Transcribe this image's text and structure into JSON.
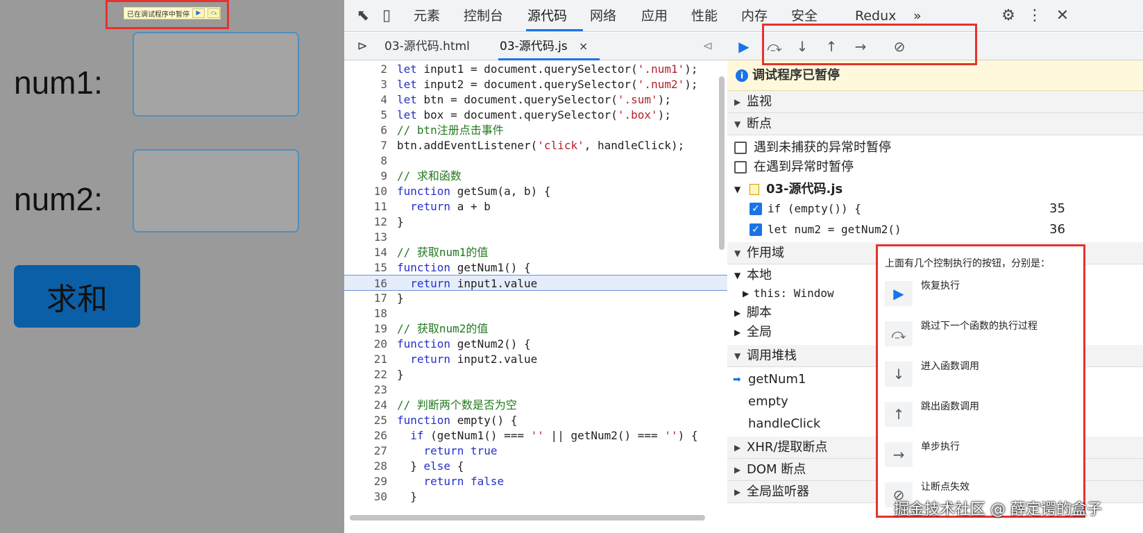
{
  "page": {
    "paused_banner": "已在调试程序中暂停",
    "num1_label": "num1:",
    "num2_label": "num2:",
    "sum_button": "求和"
  },
  "devtools": {
    "tabs": [
      "元素",
      "控制台",
      "源代码",
      "网络",
      "应用",
      "性能",
      "内存",
      "安全",
      "Redux"
    ],
    "more_tabs": "»",
    "file_tabs": [
      "03-源代码.html",
      "03-源代码.js"
    ],
    "file_tab_close": "×"
  },
  "code": {
    "lines": [
      {
        "n": "2",
        "t": "let input1 = document.querySelector('.num1');"
      },
      {
        "n": "3",
        "t": "let input2 = document.querySelector('.num2');"
      },
      {
        "n": "4",
        "t": "let btn = document.querySelector('.sum');"
      },
      {
        "n": "5",
        "t": "let box = document.querySelector('.box');"
      },
      {
        "n": "6",
        "t": "// btn注册点击事件"
      },
      {
        "n": "7",
        "t": "btn.addEventListener('click', handleClick);"
      },
      {
        "n": "8",
        "t": ""
      },
      {
        "n": "9",
        "t": "// 求和函数"
      },
      {
        "n": "10",
        "t": "function getSum(a, b) {"
      },
      {
        "n": "11",
        "t": "  return a + b"
      },
      {
        "n": "12",
        "t": "}"
      },
      {
        "n": "13",
        "t": ""
      },
      {
        "n": "14",
        "t": "// 获取num1的值"
      },
      {
        "n": "15",
        "t": "function getNum1() {"
      },
      {
        "n": "16",
        "t": "  return input1.value"
      },
      {
        "n": "17",
        "t": "}"
      },
      {
        "n": "18",
        "t": ""
      },
      {
        "n": "19",
        "t": "// 获取num2的值"
      },
      {
        "n": "20",
        "t": "function getNum2() {"
      },
      {
        "n": "21",
        "t": "  return input2.value"
      },
      {
        "n": "22",
        "t": "}"
      },
      {
        "n": "23",
        "t": ""
      },
      {
        "n": "24",
        "t": "// 判断两个数是否为空"
      },
      {
        "n": "25",
        "t": "function empty() {"
      },
      {
        "n": "26",
        "t": "  if (getNum1() === '' || getNum2() === '') {"
      },
      {
        "n": "27",
        "t": "    return true"
      },
      {
        "n": "28",
        "t": "  } else {"
      },
      {
        "n": "29",
        "t": "    return false"
      },
      {
        "n": "30",
        "t": "  }"
      }
    ],
    "current_line": "16"
  },
  "debugger": {
    "paused_text": "调试程序已暂停",
    "watch": "监视",
    "breakpoints": "断点",
    "pause_uncaught": "遇到未捕获的异常时暂停",
    "pause_caught": "在遇到异常时暂停",
    "bp_file": "03-源代码.js",
    "bp_items": [
      {
        "code": "if (empty()) {",
        "line": "35"
      },
      {
        "code": "let num2 = getNum2()",
        "line": "36"
      }
    ],
    "scope": "作用域",
    "local": "本地",
    "this_row": "this: Window",
    "script": "脚本",
    "global": "全局",
    "call_stack": "调用堆栈",
    "stack": [
      "getNum1",
      "empty",
      "handleClick"
    ],
    "xhr": "XHR/提取断点",
    "dom_bp": "DOM 断点",
    "global_listeners": "全局监听器"
  },
  "note": {
    "heading": "上面有几个控制执行的按钮，分别是：",
    "items": [
      "恢复执行",
      "跳过下一个函数的执行过程",
      "进入函数调用",
      "跳出函数调用",
      "单步执行",
      "让断点失效"
    ]
  },
  "watermark": "掘金技术社区 @ 薛定谔的盒子",
  "colors": {
    "accent": "#1a73e8",
    "annotation": "#e5322d",
    "paused_bg": "#fff8dc"
  }
}
